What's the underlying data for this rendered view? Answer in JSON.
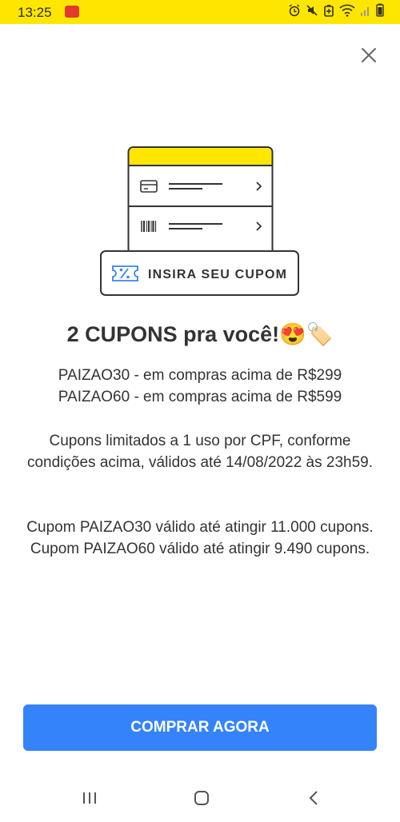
{
  "status_bar": {
    "time": "13:25",
    "background_color": "#ffe600",
    "icons": [
      "alarm-icon",
      "mute-icon",
      "battery-saver-icon",
      "wifi-icon",
      "signal-icon",
      "battery-icon"
    ]
  },
  "dialog": {
    "close_icon": "close-icon",
    "illustration": {
      "card_icon": "credit-card-icon",
      "barcode_icon": "barcode-icon",
      "coupon_icon": "coupon-percent-icon",
      "coupon_label": "INSIRA SEU CUPOM",
      "accent_color": "#ffe600",
      "icon_color": "#3483fa"
    },
    "headline": "2 CUPONS pra você!",
    "headline_emojis": "😍🏷️",
    "coupon_lines": [
      "PAIZAO30 - em compras acima de R$299",
      "PAIZAO60 - em compras acima de R$599"
    ],
    "conditions": "Cupons limitados a 1 uso por CPF, conforme condições acima, válidos até 14/08/2022 às 23h59.",
    "limits": [
      "Cupom PAIZAO30 válido até atingir 11.000 cupons.",
      "Cupom PAIZAO60 válido até atingir 9.490 cupons."
    ],
    "cta_label": "COMPRAR AGORA",
    "cta_color": "#3483fa"
  },
  "nav_bar": {
    "icons": [
      "recent-apps-icon",
      "home-icon",
      "back-icon"
    ]
  }
}
